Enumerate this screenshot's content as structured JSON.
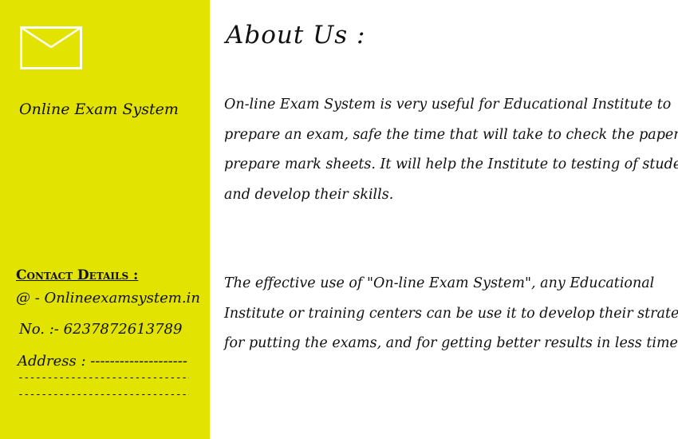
{
  "sidebar": {
    "mail_icon": "envelope-icon",
    "site_name": "Online Exam System",
    "contact": {
      "heading": "Contact Details :",
      "email": "@ - Onlineexamsystem.in",
      "phone": "No. :- 6237872613789",
      "address": "Address : --------------------",
      "address_line2": "------------------------------------",
      "address_line3": "------------------------------------"
    }
  },
  "main": {
    "title": "About Us :",
    "paragraph_1": "On-line Exam System is very useful for Educational Institute to prepare an exam, safe the time that will take to check the paper and prepare mark sheets. It will help the Institute to testing of students and develop their skills.",
    "paragraph_2": "The effective use of \"On-line Exam System\", any Educational Institute or training centers can be use it to develop their strategy for putting the exams, and for getting better results in less time."
  },
  "colors": {
    "sidebar_bg": "#e3e300",
    "text": "#111111",
    "icon_stroke": "#ffffff"
  }
}
